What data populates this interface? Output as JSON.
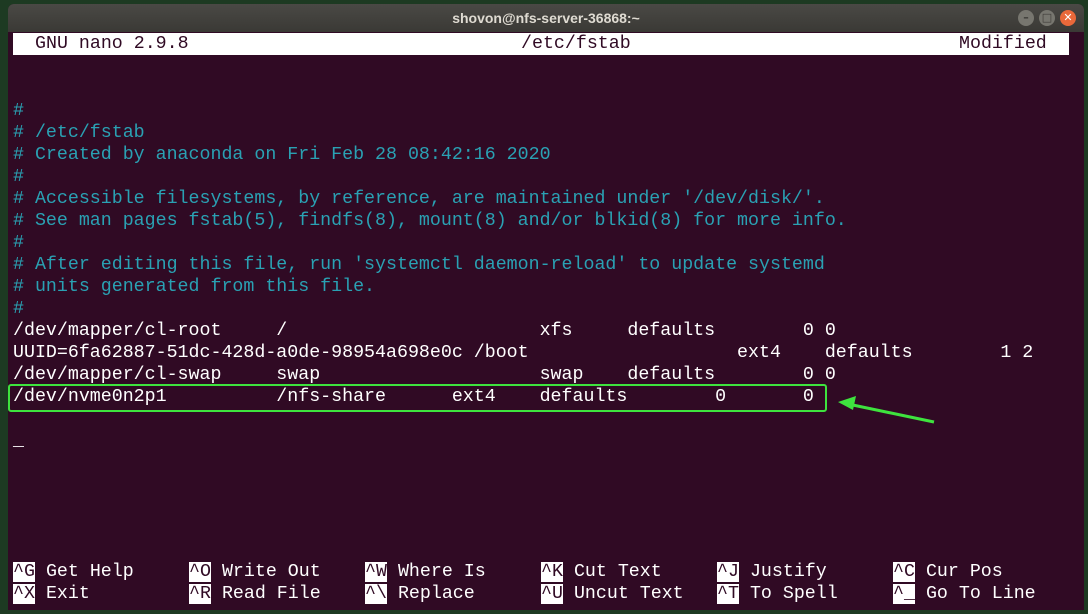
{
  "window": {
    "title": "shovon@nfs-server-36868:~"
  },
  "nano": {
    "version": "GNU nano 2.9.8",
    "filename": "/etc/fstab",
    "status": "Modified"
  },
  "lines": [
    {
      "text": "#",
      "type": "comment"
    },
    {
      "text": "# /etc/fstab",
      "type": "comment"
    },
    {
      "text": "# Created by anaconda on Fri Feb 28 08:42:16 2020",
      "type": "comment"
    },
    {
      "text": "#",
      "type": "comment"
    },
    {
      "text": "# Accessible filesystems, by reference, are maintained under '/dev/disk/'.",
      "type": "comment"
    },
    {
      "text": "# See man pages fstab(5), findfs(8), mount(8) and/or blkid(8) for more info.",
      "type": "comment"
    },
    {
      "text": "#",
      "type": "comment"
    },
    {
      "text": "# After editing this file, run 'systemctl daemon-reload' to update systemd",
      "type": "comment"
    },
    {
      "text": "# units generated from this file.",
      "type": "comment"
    },
    {
      "text": "#",
      "type": "comment"
    },
    {
      "text": "/dev/mapper/cl-root     /                       xfs     defaults        0 0",
      "type": "entry"
    },
    {
      "text": "UUID=6fa62887-51dc-428d-a0de-98954a698e0c /boot                   ext4    defaults        1 2",
      "type": "entry"
    },
    {
      "text": "/dev/mapper/cl-swap     swap                    swap    defaults        0 0",
      "type": "entry"
    },
    {
      "text": "/dev/nvme0n2p1          /nfs-share      ext4    defaults        0       0",
      "type": "entry"
    },
    {
      "text": "",
      "type": "entry"
    },
    {
      "text": "_",
      "type": "cursor"
    }
  ],
  "shortcuts": [
    {
      "key": "^G",
      "label": "Get Help"
    },
    {
      "key": "^O",
      "label": "Write Out"
    },
    {
      "key": "^W",
      "label": "Where Is"
    },
    {
      "key": "^K",
      "label": "Cut Text"
    },
    {
      "key": "^J",
      "label": "Justify"
    },
    {
      "key": "^C",
      "label": "Cur Pos"
    },
    {
      "key": "^X",
      "label": "Exit"
    },
    {
      "key": "^R",
      "label": "Read File"
    },
    {
      "key": "^\\",
      "label": "Replace"
    },
    {
      "key": "^U",
      "label": "Uncut Text"
    },
    {
      "key": "^T",
      "label": "To Spell"
    },
    {
      "key": "^_",
      "label": "Go To Line"
    }
  ],
  "colors": {
    "background": "#300a24",
    "comment": "#2aa1b3",
    "highlight": "#3ee33e"
  }
}
